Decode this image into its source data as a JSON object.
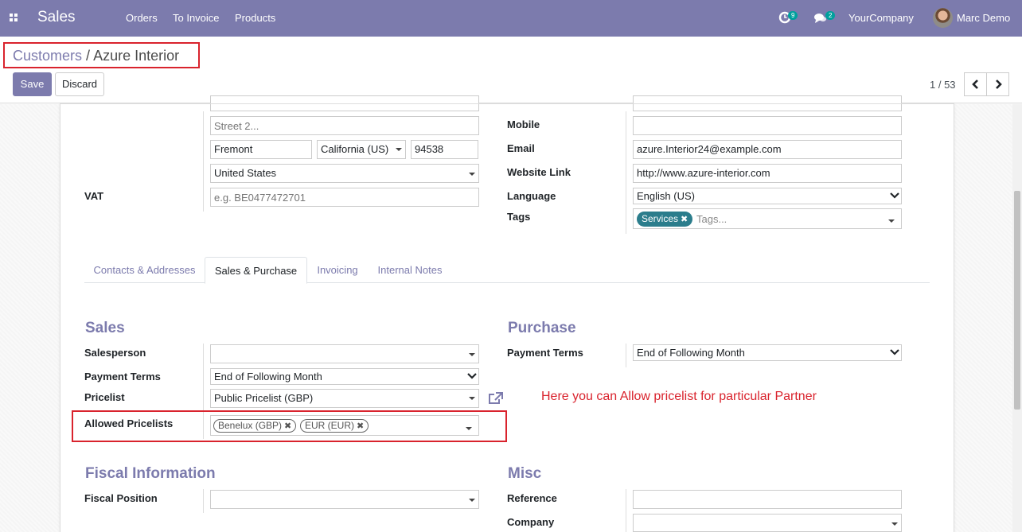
{
  "navbar": {
    "app_name": "Sales",
    "menu": [
      "Orders",
      "To Invoice",
      "Products"
    ],
    "activity_count": "9",
    "message_count": "2",
    "company": "YourCompany",
    "user": "Marc Demo"
  },
  "breadcrumb": {
    "parent": "Customers",
    "separator": "/",
    "current": "Azure Interior"
  },
  "buttons": {
    "save": "Save",
    "discard": "Discard"
  },
  "pager": {
    "text": "1 / 53"
  },
  "address": {
    "street2_placeholder": "Street 2...",
    "city": "Fremont",
    "state": "California (US)",
    "zip": "94538",
    "country": "United States",
    "vat_label": "VAT",
    "vat_placeholder": "e.g. BE0477472701"
  },
  "contact": {
    "mobile_label": "Mobile",
    "mobile": "",
    "email_label": "Email",
    "email": "azure.Interior24@example.com",
    "website_label": "Website Link",
    "website": "http://www.azure-interior.com",
    "language_label": "Language",
    "language": "English (US)",
    "tags_label": "Tags",
    "tag": "Services",
    "tags_placeholder": "Tags..."
  },
  "tabs": [
    {
      "label": "Contacts & Addresses",
      "active": false
    },
    {
      "label": "Sales & Purchase",
      "active": true
    },
    {
      "label": "Invoicing",
      "active": false
    },
    {
      "label": "Internal Notes",
      "active": false
    }
  ],
  "sales": {
    "title": "Sales",
    "salesperson_label": "Salesperson",
    "salesperson": "",
    "payment_terms_label": "Payment Terms",
    "payment_terms": "End of Following Month",
    "pricelist_label": "Pricelist",
    "pricelist": "Public Pricelist (GBP)",
    "allowed_pricelists_label": "Allowed Pricelists",
    "allowed_pricelists": [
      "Benelux (GBP)",
      "EUR (EUR)"
    ]
  },
  "purchase": {
    "title": "Purchase",
    "payment_terms_label": "Payment Terms",
    "payment_terms": "End of Following Month"
  },
  "annotation": "Here you can Allow pricelist for particular Partner",
  "fiscal": {
    "title": "Fiscal Information",
    "position_label": "Fiscal Position",
    "position": ""
  },
  "misc": {
    "title": "Misc",
    "reference_label": "Reference",
    "reference": "",
    "company_label": "Company",
    "company": ""
  },
  "colors": {
    "brand": "#7c7bad",
    "highlight": "#d9232d",
    "tag": "#2b7d8c",
    "badge": "#00a09d"
  }
}
